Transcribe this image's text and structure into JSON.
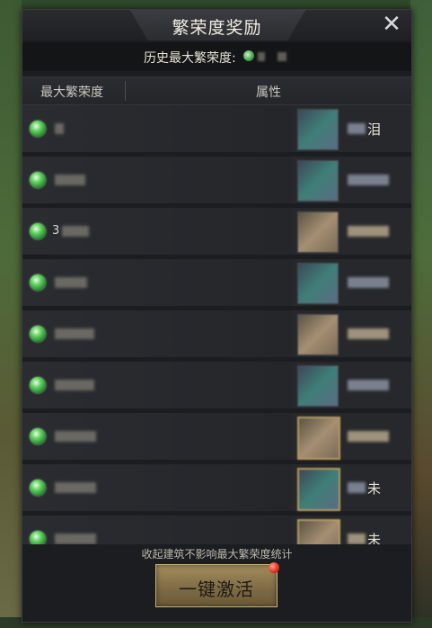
{
  "dialog": {
    "title": "繁荣度奖励",
    "close_glyph": "✕",
    "history_label": "历史最大繁荣度:"
  },
  "table": {
    "columns": [
      "最大繁荣度",
      "属性"
    ],
    "rows": [
      {
        "value": "",
        "attr_glyph": "泪",
        "icon_tone": "cool"
      },
      {
        "value": "",
        "attr_glyph": "",
        "icon_tone": "cool"
      },
      {
        "value": "3",
        "attr_glyph": "",
        "icon_tone": "warm"
      },
      {
        "value": "",
        "attr_glyph": "",
        "icon_tone": "cool"
      },
      {
        "value": "",
        "attr_glyph": "",
        "icon_tone": "warm"
      },
      {
        "value": "",
        "attr_glyph": "",
        "icon_tone": "cool"
      },
      {
        "value": "",
        "attr_glyph": "",
        "icon_tone": "warm"
      },
      {
        "value": "",
        "attr_glyph": "未",
        "icon_tone": "cool"
      },
      {
        "value": "",
        "attr_glyph": "未",
        "icon_tone": "warm"
      }
    ]
  },
  "footer": {
    "note": "收起建筑不影响最大繁荣度统计",
    "activate_label": "一键激活"
  },
  "icons": {
    "gem": "prosperity-gem-icon",
    "notification": "red-dot-badge"
  },
  "colors": {
    "panel_bg": "#1b1d21",
    "button_gold": "#a48d5d",
    "gem_green": "#5fcf5e",
    "badge_red": "#e03020"
  }
}
